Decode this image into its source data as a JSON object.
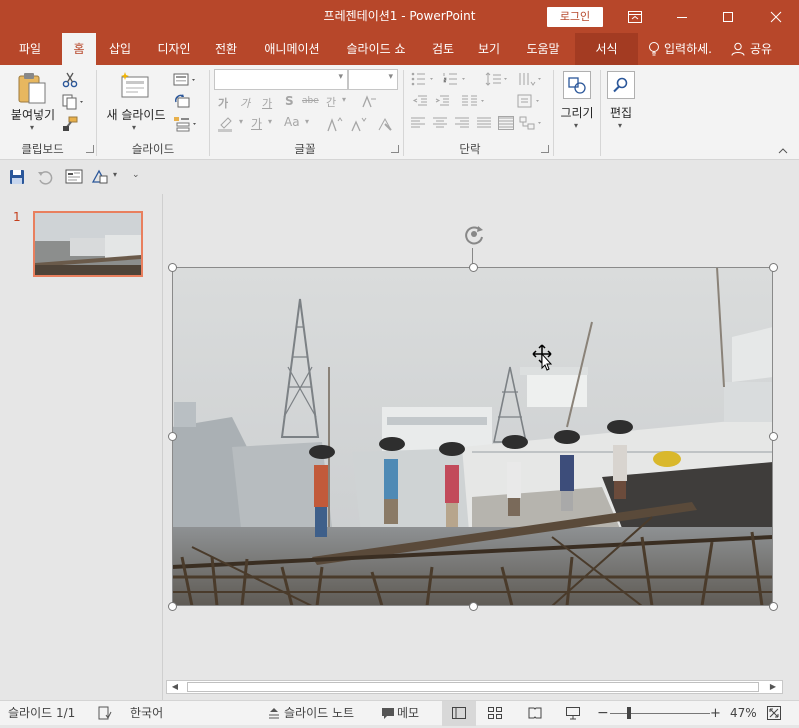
{
  "app": {
    "title": "프레젠테이션1  -  PowerPoint"
  },
  "titlebar": {
    "login_label": "로그인"
  },
  "tabs": [
    {
      "label": "파일"
    },
    {
      "label": "홈"
    },
    {
      "label": "삽입"
    },
    {
      "label": "디자인"
    },
    {
      "label": "전환"
    },
    {
      "label": "애니메이션"
    },
    {
      "label": "슬라이드 쇼"
    },
    {
      "label": "검토"
    },
    {
      "label": "보기"
    },
    {
      "label": "도움말"
    },
    {
      "label": "서식"
    }
  ],
  "tellme": {
    "label": "입력하세."
  },
  "share": {
    "label": "공유"
  },
  "ribbon": {
    "paste_label": "붙여넣기",
    "new_slide_label": "새 슬라이드",
    "draw_label": "그리기",
    "edit_label": "편집",
    "font_name_value": "",
    "font_size_value": "",
    "groups": {
      "clipboard": "클립보드",
      "slides": "슬라이드",
      "font": "글꼴",
      "paragraph": "단락"
    },
    "font_buttons": {
      "bold": "가",
      "italic": "가",
      "underline": "가",
      "shadow": "S",
      "strike": "abe",
      "spacing": "간",
      "fontcolor": "가",
      "aa": "Aa"
    }
  },
  "slides_panel": {
    "number": "1"
  },
  "status": {
    "slide_info": "슬라이드 1/1",
    "language": "한국어",
    "notes_label": "슬라이드 노트",
    "comments_label": "메모",
    "zoom": "47%"
  },
  "colors": {
    "accent": "#b7472a",
    "selection": "#e97f5e"
  }
}
